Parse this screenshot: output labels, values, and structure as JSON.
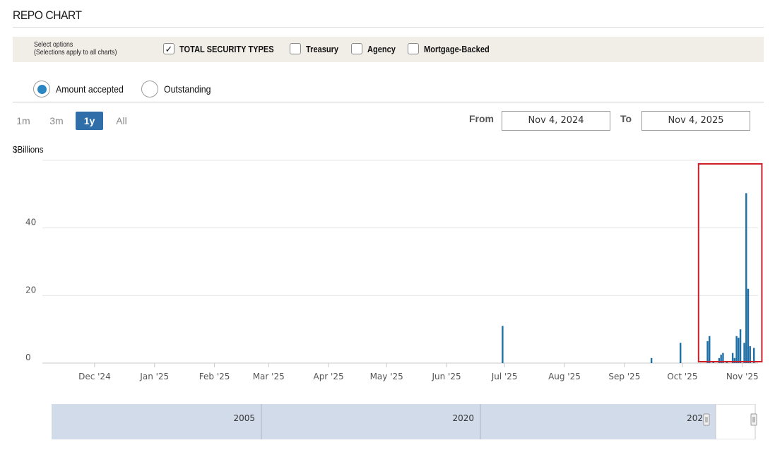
{
  "title": "REPO CHART",
  "options": {
    "hint_line1": "Select options",
    "hint_line2": "(Selections apply to all charts)",
    "checkboxes": [
      {
        "label": "TOTAL SECURITY TYPES",
        "checked": true
      },
      {
        "label": "Treasury",
        "checked": false
      },
      {
        "label": "Agency",
        "checked": false
      },
      {
        "label": "Mortgage-Backed",
        "checked": false
      }
    ]
  },
  "radios": [
    {
      "label": "Amount accepted",
      "selected": true
    },
    {
      "label": "Outstanding",
      "selected": false
    }
  ],
  "ranges": [
    {
      "label": "1m",
      "active": false
    },
    {
      "label": "3m",
      "active": false
    },
    {
      "label": "1y",
      "active": true
    },
    {
      "label": "All",
      "active": false
    }
  ],
  "date_range": {
    "from_label": "From",
    "from": "Nov 4, 2024",
    "to_label": "To",
    "to": "Nov 4, 2025"
  },
  "colors": {
    "bar": "#1f6fa6",
    "highlight_box": "#cc1f2a",
    "navigator": "#d1dbea",
    "accent": "#2f6ea8"
  },
  "chart_data": {
    "type": "bar",
    "ylabel": "$Billions",
    "ylim": [
      0,
      60
    ],
    "y_ticks": [
      "0",
      "20",
      "40"
    ],
    "y_tick_values": [
      0,
      20,
      40
    ],
    "x_tick_labels": [
      "Dec '24",
      "Jan '25",
      "Feb '25",
      "Mar '25",
      "Apr '25",
      "May '25",
      "Jun '25",
      "Jul '25",
      "Aug '25",
      "Sep '25",
      "Oct '25",
      "Nov '25"
    ],
    "x_tick_dates": [
      "2024-12-01",
      "2025-01-01",
      "2025-02-01",
      "2025-03-01",
      "2025-04-01",
      "2025-05-01",
      "2025-06-01",
      "2025-07-01",
      "2025-08-01",
      "2025-09-01",
      "2025-10-01",
      "2025-11-01"
    ],
    "xlim": [
      "2024-11-04",
      "2025-11-04"
    ],
    "grid": true,
    "bars": [
      {
        "date": "2025-06-30",
        "value": 11
      },
      {
        "date": "2025-09-15",
        "value": 1.5
      },
      {
        "date": "2025-09-30",
        "value": 6
      },
      {
        "date": "2025-10-14",
        "value": 6.5
      },
      {
        "date": "2025-10-15",
        "value": 8
      },
      {
        "date": "2025-10-17",
        "value": 0.5
      },
      {
        "date": "2025-10-20",
        "value": 1.5
      },
      {
        "date": "2025-10-21",
        "value": 2.5
      },
      {
        "date": "2025-10-22",
        "value": 3
      },
      {
        "date": "2025-10-24",
        "value": 0.5
      },
      {
        "date": "2025-10-27",
        "value": 3
      },
      {
        "date": "2025-10-28",
        "value": 1.5
      },
      {
        "date": "2025-10-29",
        "value": 8
      },
      {
        "date": "2025-10-30",
        "value": 7.5
      },
      {
        "date": "2025-10-31",
        "value": 10
      },
      {
        "date": "2025-11-02",
        "value": 6
      },
      {
        "date": "2025-11-03",
        "value": 50.3
      },
      {
        "date": "2025-11-04",
        "value": 22
      },
      {
        "date": "2025-11-05",
        "value": 5
      },
      {
        "date": "2025-11-07",
        "value": 4.5
      }
    ],
    "highlight": {
      "from": "2025-10-13",
      "to": "2025-11-10"
    }
  },
  "navigator": {
    "labels": [
      "2005",
      "2020",
      "202"
    ]
  }
}
